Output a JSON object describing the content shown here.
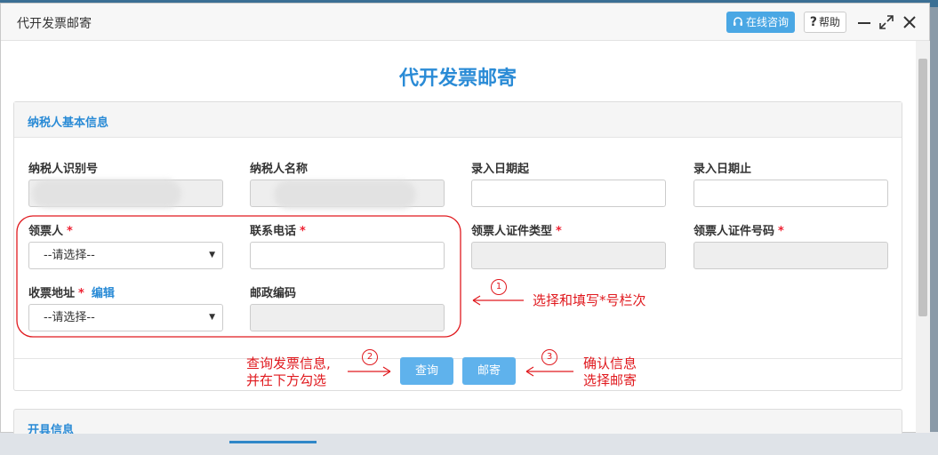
{
  "window": {
    "title": "代开发票邮寄",
    "online_consult": "在线咨询",
    "help": "帮助",
    "help_mark": "?"
  },
  "page": {
    "heading": "代开发票邮寄"
  },
  "section1": {
    "title": "纳税人基本信息",
    "fields": {
      "taxpayer_id": "纳税人识别号",
      "taxpayer_name": "纳税人名称",
      "entry_date_start": "录入日期起",
      "entry_date_end": "录入日期止",
      "receiver": "领票人",
      "phone": "联系电话",
      "receiver_id_type": "领票人证件类型",
      "receiver_id_number": "领票人证件号码",
      "address": "收票地址",
      "edit_link": "编辑",
      "postcode": "邮政编码"
    },
    "required_mark": "*",
    "select_placeholder": "--请选择--"
  },
  "buttons": {
    "query": "查询",
    "mail": "邮寄"
  },
  "section2": {
    "title": "开具信息"
  },
  "annotations": {
    "n1": "1",
    "n2": "2",
    "n3": "3",
    "a1": "选择和填写*号栏次",
    "a2_line1": "查询发票信息,",
    "a2_line2": "并在下方勾选",
    "a3_line1": "确认信息",
    "a3_line2": "选择邮寄"
  },
  "colors": {
    "accent": "#2a8bd6",
    "annotation": "#e0191e",
    "button": "#5fb2ec"
  }
}
